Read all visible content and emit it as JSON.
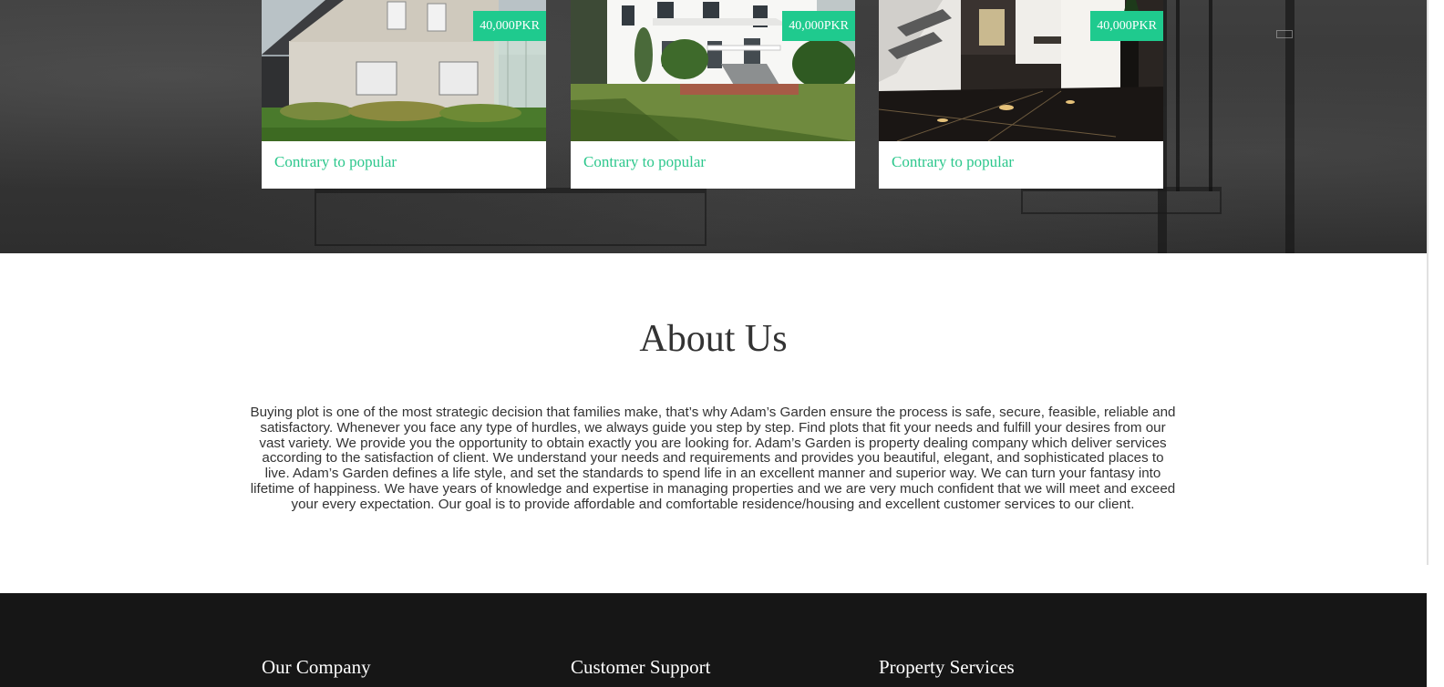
{
  "listings": [
    {
      "price": "40,000PKR",
      "title": "Contrary to popular",
      "photo": "house-exterior-image"
    },
    {
      "price": "40,000PKR",
      "title": "Contrary to popular",
      "photo": "house-porch-image"
    },
    {
      "price": "40,000PKR",
      "title": "Contrary to popular",
      "photo": "interior-hall-image"
    }
  ],
  "about": {
    "title": "About Us",
    "body": "Buying plot is one of the most strategic decision that families make, that’s why Adam’s Garden ensure the process is safe, secure, feasible, reliable and satisfactory. Whenever you face any type of hurdles, we always guide you step by step. Find plots that fit your needs and fulfill your desires from our vast variety. We provide you the opportunity to obtain exactly you are looking for. Adam’s Garden is property dealing company which deliver services according to the satisfaction of client. We understand your needs and requirements and provides you beautiful, elegant, and sophisticated places to live. Adam’s Garden defines a life style, and set the standards to spend life in an excellent manner and superior way. We can turn your fantasy into lifetime of happiness. We have years of knowledge and expertise in managing properties and we are very much confident that we will meet and exceed your every expectation. Our goal is to provide affordable and comfortable residence/housing and excellent customer services to our client."
  },
  "footer": {
    "columns": [
      {
        "heading": "Our Company"
      },
      {
        "heading": "Customer Support"
      },
      {
        "heading": "Property Services"
      }
    ]
  },
  "colors": {
    "accent": "#1fca8e",
    "caption": "#2cc78c",
    "footer_bg": "#161616"
  }
}
